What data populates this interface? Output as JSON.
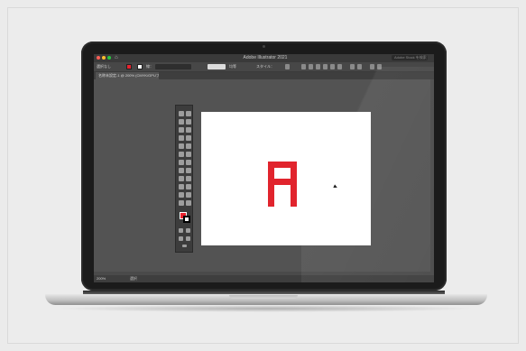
{
  "window": {
    "app_title": "Adobe Illustrator 2021",
    "search_placeholder": "Adobe Stock を検索"
  },
  "options_bar": {
    "selection_label": "選択なし",
    "stroke_label": "線：",
    "uniform_label": "均等",
    "style_label": "スタイル："
  },
  "document_tab": {
    "label": "名称未設定-1 @ 200% (CMYK/GPUプレビュー)"
  },
  "artboard": {
    "glyph_text": "A",
    "glyph_color": "#e1242d"
  },
  "status_bar": {
    "zoom_level": "200%",
    "tool_name": "選択"
  },
  "colors": {
    "fill": "#e8232e",
    "stroke": "#000000",
    "canvas_bg": "#535353"
  },
  "icons": [
    "home-icon",
    "selection-tool-icon",
    "pen-tool-icon",
    "type-tool-icon",
    "rectangle-tool-icon",
    "rotate-tool-icon",
    "eyedropper-tool-icon",
    "hand-tool-icon",
    "zoom-tool-icon",
    "pointer-cursor-icon"
  ]
}
